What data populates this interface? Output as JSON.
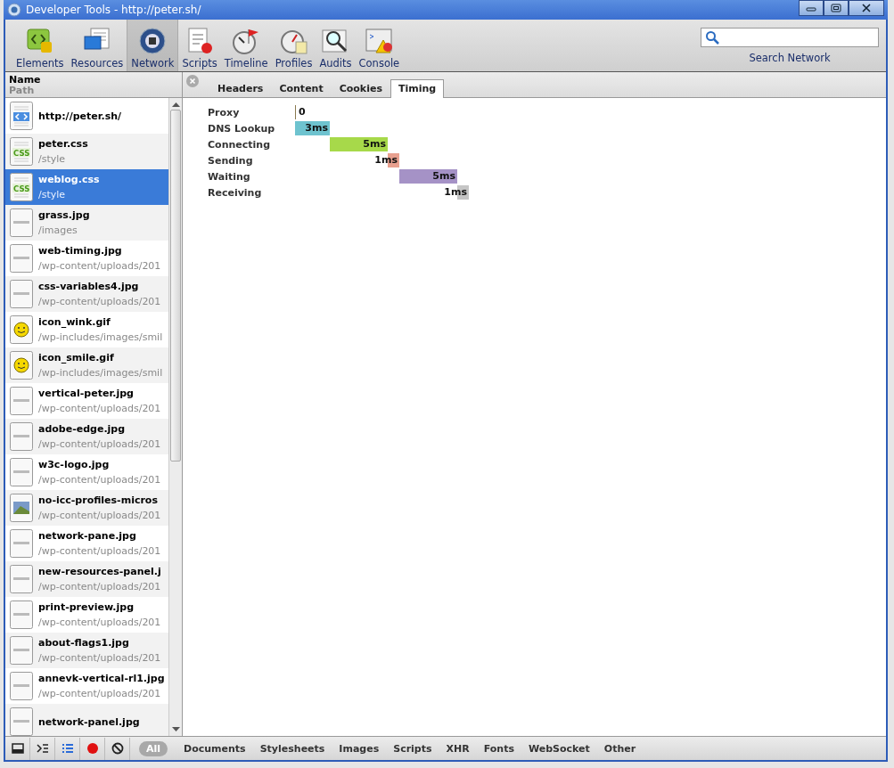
{
  "window": {
    "title": "Developer Tools - http://peter.sh/"
  },
  "toolbar": {
    "items": [
      {
        "kind": "elements",
        "label": "Elements",
        "selected": false
      },
      {
        "kind": "resources",
        "label": "Resources",
        "selected": false
      },
      {
        "kind": "network",
        "label": "Network",
        "selected": true
      },
      {
        "kind": "scripts",
        "label": "Scripts",
        "selected": false
      },
      {
        "kind": "timeline",
        "label": "Timeline",
        "selected": false
      },
      {
        "kind": "profiles",
        "label": "Profiles",
        "selected": false
      },
      {
        "kind": "audits",
        "label": "Audits",
        "selected": false
      },
      {
        "kind": "console",
        "label": "Console",
        "selected": false
      }
    ],
    "search_label": "Search Network"
  },
  "sidebar": {
    "header": {
      "name": "Name",
      "path": "Path"
    },
    "items": [
      {
        "kind": "document",
        "name": "http://peter.sh/",
        "selected": false
      },
      {
        "kind": "stylesheet",
        "badge": "CSS",
        "name": "peter.css",
        "path": "/style",
        "selected": false
      },
      {
        "kind": "stylesheet",
        "badge": "CSS",
        "name": "weblog.css",
        "path": "/style",
        "selected": true
      },
      {
        "kind": "image",
        "name": "grass.jpg",
        "path": "/images",
        "selected": false
      },
      {
        "kind": "image",
        "name": "web-timing.jpg",
        "path": "/wp-content/uploads/201",
        "selected": false
      },
      {
        "kind": "image",
        "name": "css-variables4.jpg",
        "path": "/wp-content/uploads/201",
        "selected": false
      },
      {
        "kind": "smiley",
        "name": "icon_wink.gif",
        "path": "/wp-includes/images/smil",
        "selected": false
      },
      {
        "kind": "smiley",
        "name": "icon_smile.gif",
        "path": "/wp-includes/images/smil",
        "selected": false
      },
      {
        "kind": "image",
        "name": "vertical-peter.jpg",
        "path": "/wp-content/uploads/201",
        "selected": false
      },
      {
        "kind": "image",
        "name": "adobe-edge.jpg",
        "path": "/wp-content/uploads/201",
        "selected": false
      },
      {
        "kind": "image",
        "name": "w3c-logo.jpg",
        "path": "/wp-content/uploads/201",
        "selected": false
      },
      {
        "kind": "photo",
        "name": "no-icc-profiles-micros",
        "path": "/wp-content/uploads/201",
        "selected": false
      },
      {
        "kind": "image",
        "name": "network-pane.jpg",
        "path": "/wp-content/uploads/201",
        "selected": false
      },
      {
        "kind": "image",
        "name": "new-resources-panel.j",
        "path": "/wp-content/uploads/201",
        "selected": false
      },
      {
        "kind": "image",
        "name": "print-preview.jpg",
        "path": "/wp-content/uploads/201",
        "selected": false
      },
      {
        "kind": "image",
        "name": "about-flags1.jpg",
        "path": "/wp-content/uploads/201",
        "selected": false
      },
      {
        "kind": "image",
        "name": "annevk-vertical-rl1.jpg",
        "path": "/wp-content/uploads/201",
        "selected": false
      },
      {
        "kind": "image",
        "name": "network-panel.jpg",
        "selected": false
      }
    ]
  },
  "detail": {
    "tabs": [
      {
        "label": "Headers",
        "selected": false
      },
      {
        "label": "Content",
        "selected": false
      },
      {
        "label": "Cookies",
        "selected": false
      },
      {
        "label": "Timing",
        "selected": true
      }
    ],
    "timing": [
      {
        "label": "Proxy",
        "reading": "0",
        "color": "#8a7a50"
      },
      {
        "label": "DNS Lookup",
        "reading": "3ms",
        "color": "#6ec3cf"
      },
      {
        "label": "Connecting",
        "reading": "5ms",
        "color": "#a7d94a"
      },
      {
        "label": "Sending",
        "reading": "1ms",
        "color": "#e8a08f"
      },
      {
        "label": "Waiting",
        "reading": "5ms",
        "color": "#a592c6"
      },
      {
        "label": "Receiving",
        "reading": "1ms",
        "color": "#c5c5c5"
      }
    ]
  },
  "status_bar": {
    "buttons": [
      {
        "kind": "dock",
        "on": false
      },
      {
        "kind": "console",
        "on": false
      },
      {
        "kind": "large-rows",
        "on": true
      },
      {
        "kind": "record",
        "on": true
      },
      {
        "kind": "clear",
        "on": false
      }
    ],
    "filters": [
      {
        "label": "All",
        "selected": true
      },
      {
        "label": "Documents",
        "selected": false
      },
      {
        "label": "Stylesheets",
        "selected": false
      },
      {
        "label": "Images",
        "selected": false
      },
      {
        "label": "Scripts",
        "selected": false
      },
      {
        "label": "XHR",
        "selected": false
      },
      {
        "label": "Fonts",
        "selected": false
      },
      {
        "label": "WebSocket",
        "selected": false
      },
      {
        "label": "Other",
        "selected": false
      }
    ]
  }
}
